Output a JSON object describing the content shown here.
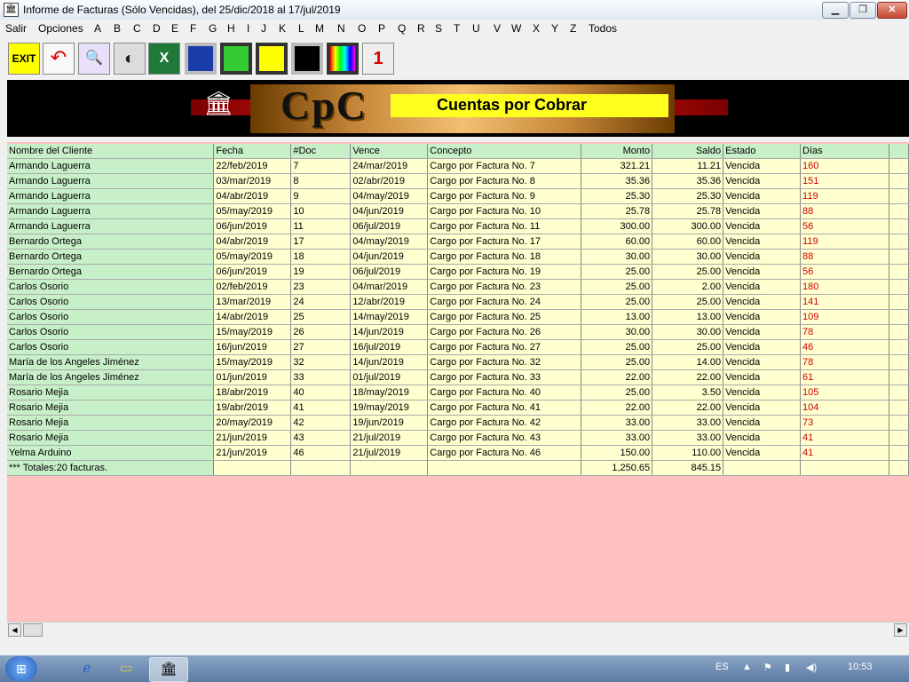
{
  "window": {
    "title": "Informe de Facturas (Sólo Vencidas), del 25/dic/2018 al 17/jul/2019",
    "min": "▁",
    "max": "❐",
    "close": "✕"
  },
  "menu": [
    "Salir",
    "Opciones",
    "A",
    "B",
    "C",
    "D",
    "E",
    "F",
    "G",
    "H",
    "I",
    "J",
    "K",
    "L",
    "M",
    "N",
    "O",
    "P",
    "Q",
    "R",
    "S",
    "T",
    "U",
    "V",
    "W",
    "X",
    "Y",
    "Z",
    "Todos"
  ],
  "toolbar": [
    {
      "name": "exit",
      "label": "EXIT"
    },
    {
      "name": "undo",
      "label": "↶"
    },
    {
      "name": "search",
      "label": "🔍"
    },
    {
      "name": "zoom",
      "label": "◐"
    },
    {
      "name": "excel",
      "label": "X"
    },
    {
      "name": "screen-blue",
      "label": ""
    },
    {
      "name": "keyboard",
      "label": ""
    },
    {
      "name": "display-yellow",
      "label": ""
    },
    {
      "name": "monitor",
      "label": ""
    },
    {
      "name": "color-bars",
      "label": ""
    },
    {
      "name": "printer",
      "label": "1"
    }
  ],
  "banner": {
    "logo": "CpC",
    "subtitle": "Cuentas por Cobrar"
  },
  "table": {
    "headers": [
      "Nombre del Cliente",
      "Fecha",
      "#Doc",
      "Vence",
      "Concepto",
      "Monto",
      "Saldo",
      "Estado",
      "Días"
    ],
    "rows": [
      [
        "Armando Laguerra",
        "22/feb/2019",
        "7",
        "24/mar/2019",
        "Cargo por Factura No. 7",
        "321.21",
        "11.21",
        "Vencida",
        "160"
      ],
      [
        "Armando Laguerra",
        "03/mar/2019",
        "8",
        "02/abr/2019",
        "Cargo por Factura No. 8",
        "35.36",
        "35.36",
        "Vencida",
        "151"
      ],
      [
        "Armando Laguerra",
        "04/abr/2019",
        "9",
        "04/may/2019",
        "Cargo por Factura No. 9",
        "25.30",
        "25.30",
        "Vencida",
        "119"
      ],
      [
        "Armando Laguerra",
        "05/may/2019",
        "10",
        "04/jun/2019",
        "Cargo por Factura No. 10",
        "25.78",
        "25.78",
        "Vencida",
        "88"
      ],
      [
        "Armando Laguerra",
        "06/jun/2019",
        "11",
        "06/jul/2019",
        "Cargo por Factura No. 11",
        "300.00",
        "300.00",
        "Vencida",
        "56"
      ],
      [
        "Bernardo Ortega",
        "04/abr/2019",
        "17",
        "04/may/2019",
        "Cargo por Factura No. 17",
        "60.00",
        "60.00",
        "Vencida",
        "119"
      ],
      [
        "Bernardo Ortega",
        "05/may/2019",
        "18",
        "04/jun/2019",
        "Cargo por Factura No. 18",
        "30.00",
        "30.00",
        "Vencida",
        "88"
      ],
      [
        "Bernardo Ortega",
        "06/jun/2019",
        "19",
        "06/jul/2019",
        "Cargo por Factura No. 19",
        "25.00",
        "25.00",
        "Vencida",
        "56"
      ],
      [
        "Carlos Osorio",
        "02/feb/2019",
        "23",
        "04/mar/2019",
        "Cargo por Factura No. 23",
        "25.00",
        "2.00",
        "Vencida",
        "180"
      ],
      [
        "Carlos Osorio",
        "13/mar/2019",
        "24",
        "12/abr/2019",
        "Cargo por Factura No. 24",
        "25.00",
        "25.00",
        "Vencida",
        "141"
      ],
      [
        "Carlos Osorio",
        "14/abr/2019",
        "25",
        "14/may/2019",
        "Cargo por Factura No. 25",
        "13.00",
        "13.00",
        "Vencida",
        "109"
      ],
      [
        "Carlos Osorio",
        "15/may/2019",
        "26",
        "14/jun/2019",
        "Cargo por Factura No. 26",
        "30.00",
        "30.00",
        "Vencida",
        "78"
      ],
      [
        "Carlos Osorio",
        "16/jun/2019",
        "27",
        "16/jul/2019",
        "Cargo por Factura No. 27",
        "25.00",
        "25.00",
        "Vencida",
        "46"
      ],
      [
        "María de los Angeles Jiménez",
        "15/may/2019",
        "32",
        "14/jun/2019",
        "Cargo por Factura No. 32",
        "25.00",
        "14.00",
        "Vencida",
        "78"
      ],
      [
        "María de los Angeles Jiménez",
        "01/jun/2019",
        "33",
        "01/jul/2019",
        "Cargo por Factura No. 33",
        "22.00",
        "22.00",
        "Vencida",
        "61"
      ],
      [
        "Rosario Mejia",
        "18/abr/2019",
        "40",
        "18/may/2019",
        "Cargo por Factura No. 40",
        "25.00",
        "3.50",
        "Vencida",
        "105"
      ],
      [
        "Rosario Mejia",
        "19/abr/2019",
        "41",
        "19/may/2019",
        "Cargo por Factura No. 41",
        "22.00",
        "22.00",
        "Vencida",
        "104"
      ],
      [
        "Rosario Mejia",
        "20/may/2019",
        "42",
        "19/jun/2019",
        "Cargo por Factura No. 42",
        "33.00",
        "33.00",
        "Vencida",
        "73"
      ],
      [
        "Rosario Mejia",
        "21/jun/2019",
        "43",
        "21/jul/2019",
        "Cargo por Factura No. 43",
        "33.00",
        "33.00",
        "Vencida",
        "41"
      ],
      [
        "Yelma Arduino",
        "21/jun/2019",
        "46",
        "21/jul/2019",
        "Cargo por Factura No. 46",
        "150.00",
        "110.00",
        "Vencida",
        "41"
      ]
    ],
    "totals": {
      "label": "*** Totales:20 facturas.",
      "monto": "1,250.65",
      "saldo": "845.15"
    }
  },
  "taskbar": {
    "lang": "ES",
    "time": "10:53"
  },
  "colors": {
    "header_green": "#c8f0c8",
    "row_yellow": "#ffffd0",
    "days_red": "#d00000",
    "empty_pink": "#ffc0c0"
  }
}
